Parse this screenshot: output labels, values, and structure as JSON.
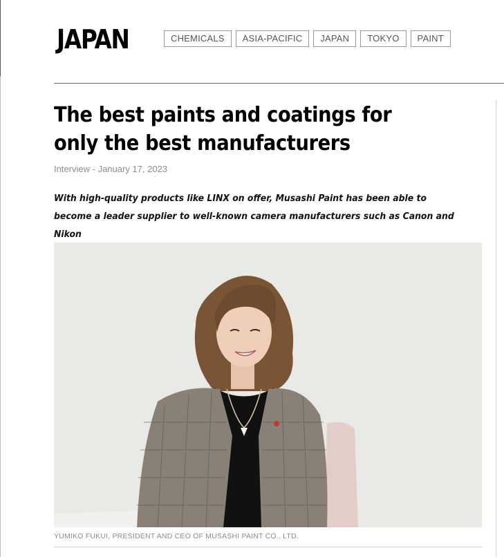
{
  "site": {
    "section_title": "JAPAN"
  },
  "tags": [
    "CHEMICALS",
    "ASIA-PACIFIC",
    "JAPAN",
    "TOKYO",
    "PAINT"
  ],
  "article": {
    "headline": "The best paints and coatings for only the best manufacturers",
    "meta": "Interview - January 17, 2023",
    "standfirst": "With high-quality products like LINX on offer, Musashi Paint has been able to become a leader supplier to well-known camera manufacturers such as Canon and Nikon",
    "photo_caption": "YUMIKO FUKUI, PRESIDENT AND CEO OF MUSASHI PAINT CO., LTD."
  },
  "colors": {
    "photo_background": "#e9e9e5",
    "jacket": "#8a8176",
    "hair": "#7a5535",
    "chair": "#e3cdc8"
  }
}
